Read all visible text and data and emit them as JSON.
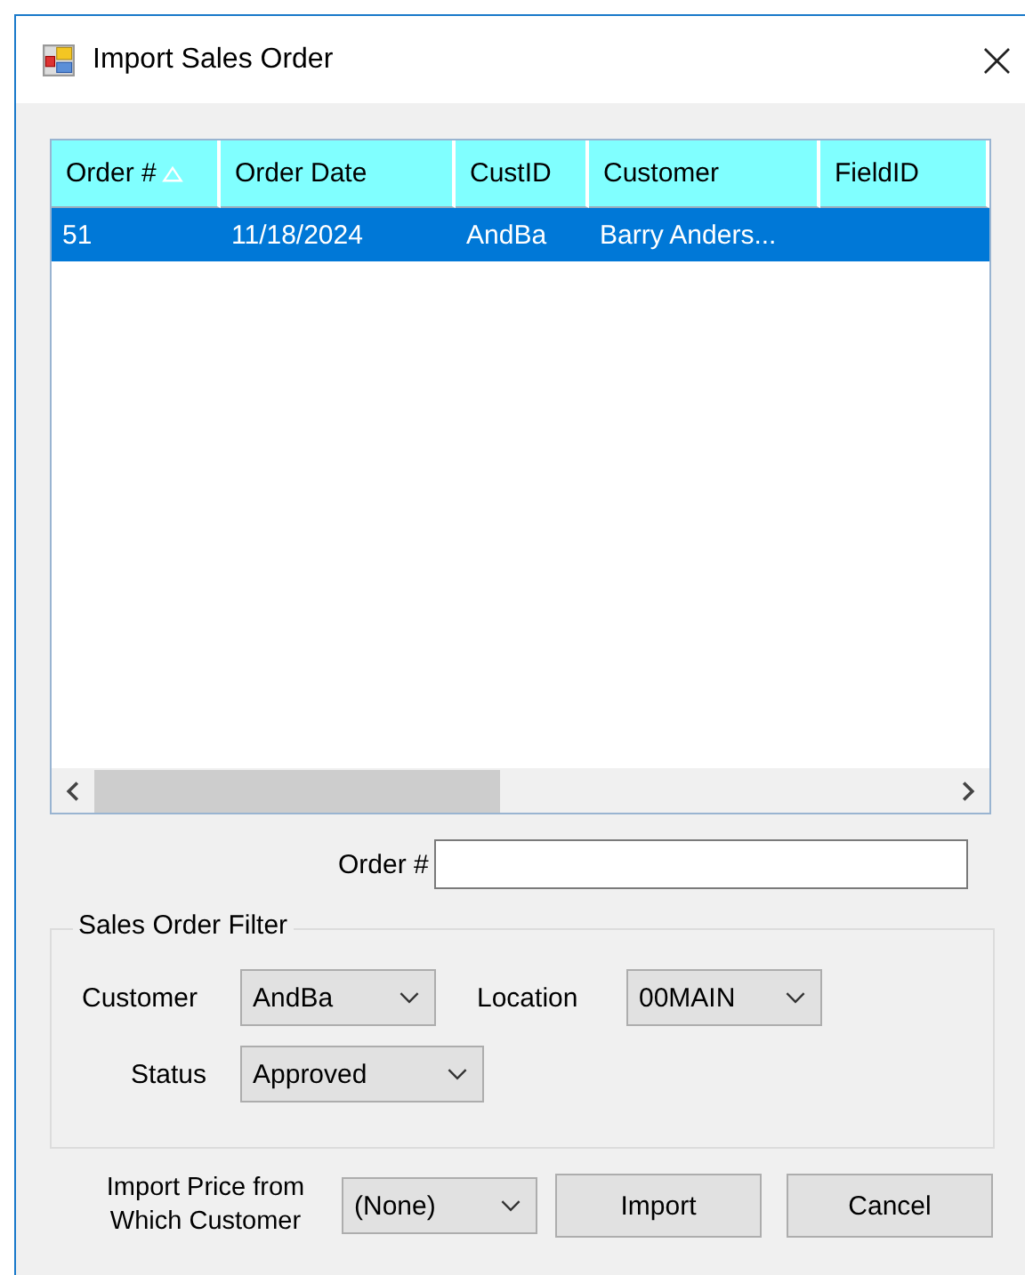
{
  "window": {
    "title": "Import Sales Order",
    "close": "×"
  },
  "table": {
    "columns": [
      {
        "label": "Order #",
        "sorted": true
      },
      {
        "label": "Order Date",
        "sorted": false
      },
      {
        "label": "CustID",
        "sorted": false
      },
      {
        "label": "Customer",
        "sorted": false
      },
      {
        "label": "FieldID",
        "sorted": false
      }
    ],
    "rows": [
      {
        "selected": true,
        "cells": [
          "51",
          "11/18/2024",
          "AndBa",
          "Barry Anders...",
          ""
        ]
      }
    ]
  },
  "order_field": {
    "label": "Order #"
  },
  "filter": {
    "title": "Sales Order Filter",
    "customer": {
      "label": "Customer",
      "value": "AndBa"
    },
    "location": {
      "label": "Location",
      "value": "00MAIN"
    },
    "status": {
      "label": "Status",
      "value": "Approved"
    }
  },
  "price_from": {
    "label": "Import Price from Which Customer",
    "value": "(None)"
  },
  "buttons": [
    "Import",
    "Cancel"
  ]
}
